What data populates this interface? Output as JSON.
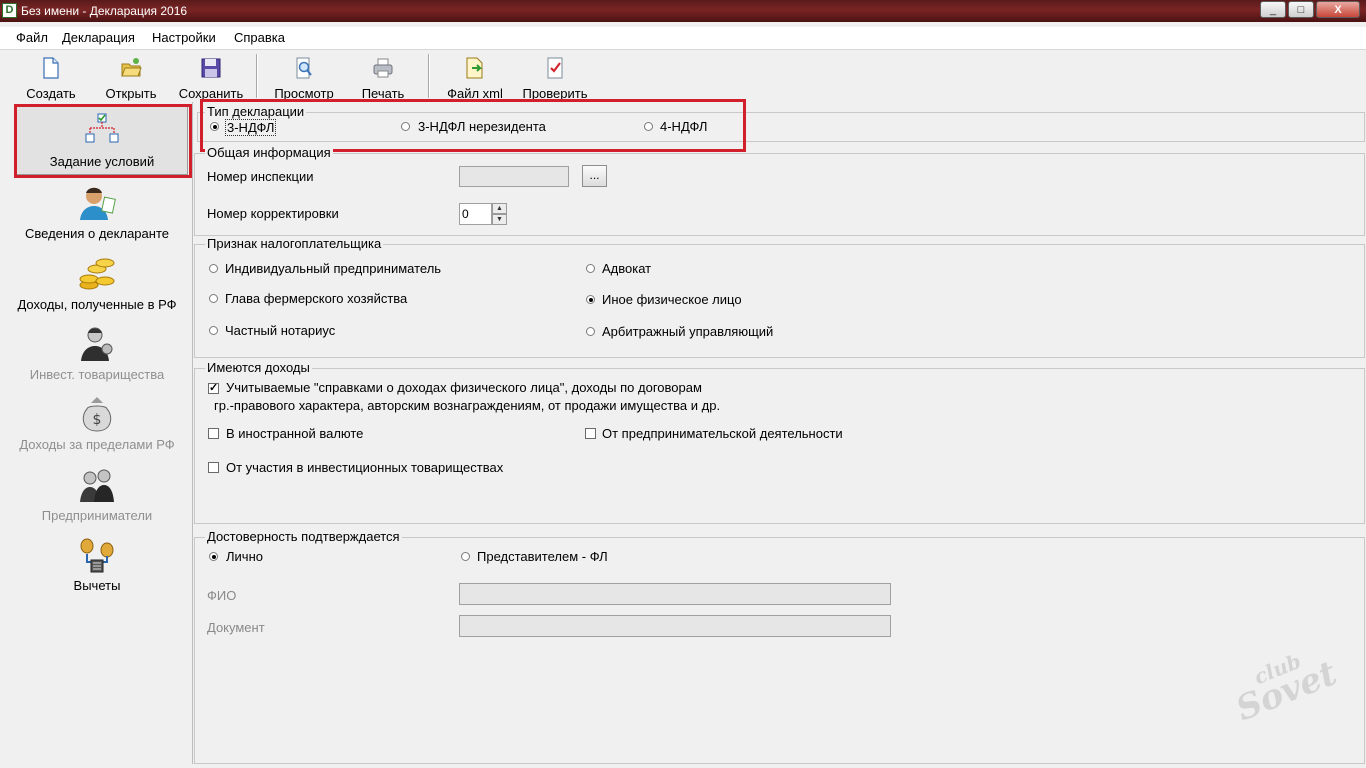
{
  "window": {
    "title": "Без имени - Декларация 2016",
    "app_icon_letter": "D",
    "controls": {
      "minimize": "_",
      "maximize": "□",
      "close": "X"
    }
  },
  "menu": [
    "Файл",
    "Декларация",
    "Настройки",
    "Справка"
  ],
  "toolbar": [
    {
      "label": "Создать",
      "icon": "new-document-icon"
    },
    {
      "label": "Открыть",
      "icon": "open-folder-icon"
    },
    {
      "label": "Сохранить",
      "icon": "floppy-disk-icon"
    },
    {
      "label": "Просмотр",
      "icon": "preview-icon"
    },
    {
      "label": "Печать",
      "icon": "printer-icon"
    },
    {
      "label": "Файл xml",
      "icon": "xml-file-icon"
    },
    {
      "label": "Проверить",
      "icon": "check-document-icon"
    }
  ],
  "sidebar": [
    {
      "label": "Задание условий",
      "icon": "conditions-tree-icon",
      "active": true,
      "disabled": false
    },
    {
      "label": "Сведения о декларанте",
      "icon": "person-icon",
      "active": false,
      "disabled": false
    },
    {
      "label": "Доходы, полученные в РФ",
      "icon": "coins-icon",
      "active": false,
      "disabled": false
    },
    {
      "label": "Инвест. товарищества",
      "icon": "investor-icon",
      "active": false,
      "disabled": true
    },
    {
      "label": "Доходы за пределами РФ",
      "icon": "money-bag-icon",
      "active": false,
      "disabled": true
    },
    {
      "label": "Предприниматели",
      "icon": "businessmen-icon",
      "active": false,
      "disabled": true
    },
    {
      "label": "Вычеты",
      "icon": "scales-icon",
      "active": false,
      "disabled": false
    }
  ],
  "declaration_type": {
    "title": "Тип декларации",
    "options": [
      {
        "label": "3-НДФЛ",
        "selected": true
      },
      {
        "label": "3-НДФЛ нерезидента",
        "selected": false
      },
      {
        "label": "4-НДФЛ",
        "selected": false
      }
    ]
  },
  "general_info": {
    "title": "Общая информация",
    "inspection_label": "Номер инспекции",
    "inspection_value": "",
    "browse_button": "...",
    "correction_label": "Номер корректировки",
    "correction_value": "0"
  },
  "taxpayer": {
    "title": "Признак налогоплательщика",
    "options": [
      {
        "label": "Индивидуальный предприниматель",
        "selected": false
      },
      {
        "label": "Адвокат",
        "selected": false
      },
      {
        "label": "Глава фермерского хозяйства",
        "selected": false
      },
      {
        "label": "Иное физическое лицо",
        "selected": true
      },
      {
        "label": "Частный нотариус",
        "selected": false
      },
      {
        "label": "Арбитражный управляющий",
        "selected": false
      }
    ]
  },
  "income": {
    "title": "Имеются доходы",
    "items": [
      {
        "line1": "Учитываемые \"справками о доходах физического лица\", доходы по договорам",
        "line2": "гр.-правового характера, авторским вознаграждениям, от продажи имущества и др.",
        "checked": true
      },
      {
        "label": "В иностранной валюте",
        "checked": false
      },
      {
        "label": "От предпринимательской деятельности",
        "checked": false
      },
      {
        "label": "От участия в инвестиционных товариществах",
        "checked": false
      }
    ]
  },
  "confirmation": {
    "title": "Достоверность подтверждается",
    "options": [
      {
        "label": "Лично",
        "selected": true
      },
      {
        "label": "Представителем - ФЛ",
        "selected": false
      }
    ],
    "fio_label": "ФИО",
    "fio_value": "",
    "document_label": "Документ",
    "document_value": ""
  },
  "watermark": {
    "line1": "club",
    "line2": "Sovet"
  },
  "colors": {
    "highlight": "#d21f2c",
    "titlebar": "#6a1f1f"
  }
}
